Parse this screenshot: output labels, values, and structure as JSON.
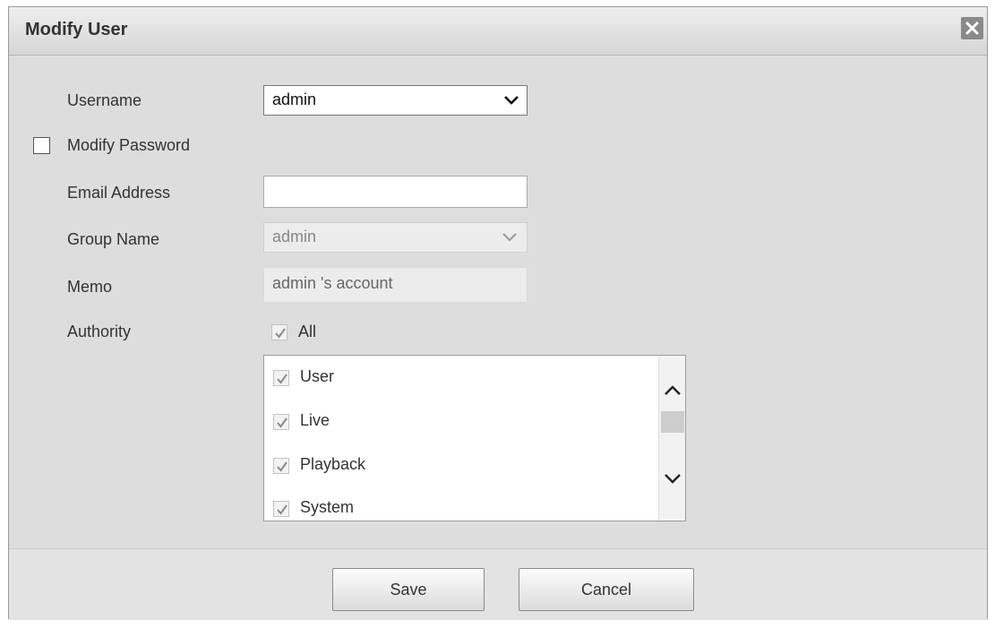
{
  "dialog": {
    "title": "Modify User",
    "close_icon": "close-x-icon"
  },
  "form": {
    "username": {
      "label": "Username",
      "value": "admin"
    },
    "modify_password": {
      "label": "Modify Password",
      "checked": false
    },
    "email": {
      "label": "Email Address",
      "value": ""
    },
    "group": {
      "label": "Group Name",
      "value": "admin"
    },
    "memo": {
      "label": "Memo",
      "value": "admin 's account"
    },
    "authority": {
      "label": "Authority",
      "all_label": "All",
      "all_checked": true,
      "items": [
        {
          "label": "User",
          "checked": true
        },
        {
          "label": "Live",
          "checked": true
        },
        {
          "label": "Playback",
          "checked": true
        },
        {
          "label": "System",
          "checked": true
        }
      ]
    }
  },
  "footer": {
    "save_label": "Save",
    "cancel_label": "Cancel"
  },
  "colors": {
    "dialog_bg": "#dddddd",
    "titlebar_bg": "#e4e4e4",
    "close_button_bg": "#8a8a8a"
  }
}
